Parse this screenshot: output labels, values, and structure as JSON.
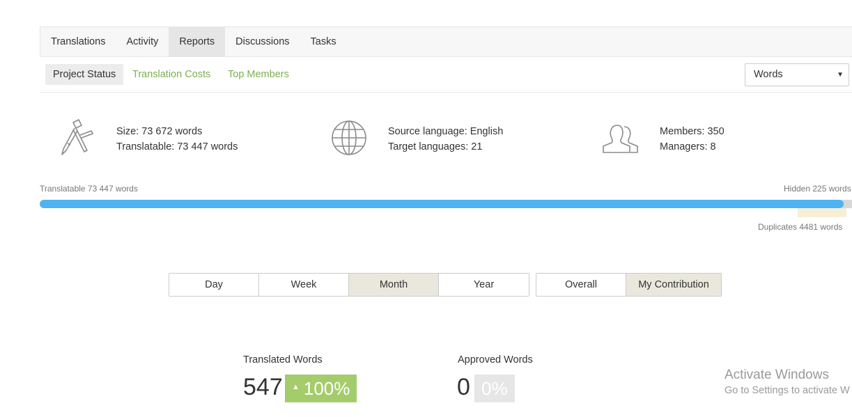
{
  "tabs": [
    {
      "label": "Translations"
    },
    {
      "label": "Activity"
    },
    {
      "label": "Reports"
    },
    {
      "label": "Discussions"
    },
    {
      "label": "Tasks"
    }
  ],
  "subnav": {
    "items": [
      {
        "label": "Project Status"
      },
      {
        "label": "Translation Costs"
      },
      {
        "label": "Top Members"
      }
    ],
    "unit_select": "Words"
  },
  "stats": {
    "size": "Size: 73 672 words",
    "translatable": "Translatable: 73 447 words",
    "source_language": "Source language: English",
    "target_languages": "Target languages: 21",
    "members": "Members: 350",
    "managers": "Managers: 8"
  },
  "progress": {
    "translatable_caption": "Translatable 73 447 words",
    "hidden_caption": "Hidden 225 words",
    "duplicates_caption": "Duplicates 4481 words",
    "translatable_words": 73447,
    "hidden_words": 225,
    "duplicates_words": 4481
  },
  "periods": [
    "Day",
    "Week",
    "Month",
    "Year"
  ],
  "scopes": [
    "Overall",
    "My Contribution"
  ],
  "metrics": {
    "translated_label": "Translated Words",
    "translated_value": "547",
    "translated_change": "100%",
    "approved_label": "Approved Words",
    "approved_value": "0",
    "approved_change": "0%"
  },
  "watermark": {
    "title": "Activate Windows",
    "subtitle": "Go to Settings to activate W"
  },
  "colors": {
    "accent_link": "#7fae4f",
    "progress_fill": "#4db3f1",
    "badge_up": "#a5cc6b",
    "duplicates": "#f6efd6"
  }
}
